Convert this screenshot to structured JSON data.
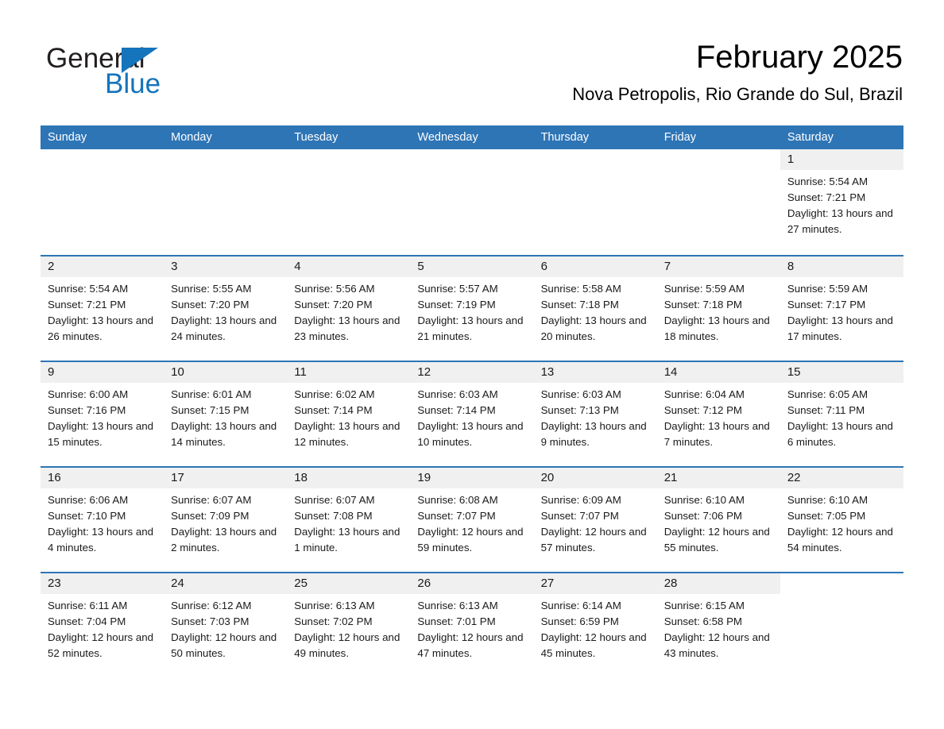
{
  "brand": {
    "name_part1": "General",
    "name_part2": "Blue",
    "accent_color": "#1474bc",
    "triangle_icon": "triangle-right-icon"
  },
  "header": {
    "title": "February 2025",
    "subtitle": "Nova Petropolis, Rio Grande do Sul, Brazil"
  },
  "colors": {
    "header_blue": "#2e75b6",
    "daynum_band": "#f0f0f0",
    "text": "#1a1a1a"
  },
  "weekdays": [
    "Sunday",
    "Monday",
    "Tuesday",
    "Wednesday",
    "Thursday",
    "Friday",
    "Saturday"
  ],
  "weeks": [
    [
      {
        "day": "",
        "sunrise": "",
        "sunset": "",
        "daylight": "",
        "empty": true
      },
      {
        "day": "",
        "sunrise": "",
        "sunset": "",
        "daylight": "",
        "empty": true
      },
      {
        "day": "",
        "sunrise": "",
        "sunset": "",
        "daylight": "",
        "empty": true
      },
      {
        "day": "",
        "sunrise": "",
        "sunset": "",
        "daylight": "",
        "empty": true
      },
      {
        "day": "",
        "sunrise": "",
        "sunset": "",
        "daylight": "",
        "empty": true
      },
      {
        "day": "",
        "sunrise": "",
        "sunset": "",
        "daylight": "",
        "empty": true
      },
      {
        "day": "1",
        "sunrise": "Sunrise: 5:54 AM",
        "sunset": "Sunset: 7:21 PM",
        "daylight": "Daylight: 13 hours and 27 minutes.",
        "empty": false
      }
    ],
    [
      {
        "day": "2",
        "sunrise": "Sunrise: 5:54 AM",
        "sunset": "Sunset: 7:21 PM",
        "daylight": "Daylight: 13 hours and 26 minutes.",
        "empty": false
      },
      {
        "day": "3",
        "sunrise": "Sunrise: 5:55 AM",
        "sunset": "Sunset: 7:20 PM",
        "daylight": "Daylight: 13 hours and 24 minutes.",
        "empty": false
      },
      {
        "day": "4",
        "sunrise": "Sunrise: 5:56 AM",
        "sunset": "Sunset: 7:20 PM",
        "daylight": "Daylight: 13 hours and 23 minutes.",
        "empty": false
      },
      {
        "day": "5",
        "sunrise": "Sunrise: 5:57 AM",
        "sunset": "Sunset: 7:19 PM",
        "daylight": "Daylight: 13 hours and 21 minutes.",
        "empty": false
      },
      {
        "day": "6",
        "sunrise": "Sunrise: 5:58 AM",
        "sunset": "Sunset: 7:18 PM",
        "daylight": "Daylight: 13 hours and 20 minutes.",
        "empty": false
      },
      {
        "day": "7",
        "sunrise": "Sunrise: 5:59 AM",
        "sunset": "Sunset: 7:18 PM",
        "daylight": "Daylight: 13 hours and 18 minutes.",
        "empty": false
      },
      {
        "day": "8",
        "sunrise": "Sunrise: 5:59 AM",
        "sunset": "Sunset: 7:17 PM",
        "daylight": "Daylight: 13 hours and 17 minutes.",
        "empty": false
      }
    ],
    [
      {
        "day": "9",
        "sunrise": "Sunrise: 6:00 AM",
        "sunset": "Sunset: 7:16 PM",
        "daylight": "Daylight: 13 hours and 15 minutes.",
        "empty": false
      },
      {
        "day": "10",
        "sunrise": "Sunrise: 6:01 AM",
        "sunset": "Sunset: 7:15 PM",
        "daylight": "Daylight: 13 hours and 14 minutes.",
        "empty": false
      },
      {
        "day": "11",
        "sunrise": "Sunrise: 6:02 AM",
        "sunset": "Sunset: 7:14 PM",
        "daylight": "Daylight: 13 hours and 12 minutes.",
        "empty": false
      },
      {
        "day": "12",
        "sunrise": "Sunrise: 6:03 AM",
        "sunset": "Sunset: 7:14 PM",
        "daylight": "Daylight: 13 hours and 10 minutes.",
        "empty": false
      },
      {
        "day": "13",
        "sunrise": "Sunrise: 6:03 AM",
        "sunset": "Sunset: 7:13 PM",
        "daylight": "Daylight: 13 hours and 9 minutes.",
        "empty": false
      },
      {
        "day": "14",
        "sunrise": "Sunrise: 6:04 AM",
        "sunset": "Sunset: 7:12 PM",
        "daylight": "Daylight: 13 hours and 7 minutes.",
        "empty": false
      },
      {
        "day": "15",
        "sunrise": "Sunrise: 6:05 AM",
        "sunset": "Sunset: 7:11 PM",
        "daylight": "Daylight: 13 hours and 6 minutes.",
        "empty": false
      }
    ],
    [
      {
        "day": "16",
        "sunrise": "Sunrise: 6:06 AM",
        "sunset": "Sunset: 7:10 PM",
        "daylight": "Daylight: 13 hours and 4 minutes.",
        "empty": false
      },
      {
        "day": "17",
        "sunrise": "Sunrise: 6:07 AM",
        "sunset": "Sunset: 7:09 PM",
        "daylight": "Daylight: 13 hours and 2 minutes.",
        "empty": false
      },
      {
        "day": "18",
        "sunrise": "Sunrise: 6:07 AM",
        "sunset": "Sunset: 7:08 PM",
        "daylight": "Daylight: 13 hours and 1 minute.",
        "empty": false
      },
      {
        "day": "19",
        "sunrise": "Sunrise: 6:08 AM",
        "sunset": "Sunset: 7:07 PM",
        "daylight": "Daylight: 12 hours and 59 minutes.",
        "empty": false
      },
      {
        "day": "20",
        "sunrise": "Sunrise: 6:09 AM",
        "sunset": "Sunset: 7:07 PM",
        "daylight": "Daylight: 12 hours and 57 minutes.",
        "empty": false
      },
      {
        "day": "21",
        "sunrise": "Sunrise: 6:10 AM",
        "sunset": "Sunset: 7:06 PM",
        "daylight": "Daylight: 12 hours and 55 minutes.",
        "empty": false
      },
      {
        "day": "22",
        "sunrise": "Sunrise: 6:10 AM",
        "sunset": "Sunset: 7:05 PM",
        "daylight": "Daylight: 12 hours and 54 minutes.",
        "empty": false
      }
    ],
    [
      {
        "day": "23",
        "sunrise": "Sunrise: 6:11 AM",
        "sunset": "Sunset: 7:04 PM",
        "daylight": "Daylight: 12 hours and 52 minutes.",
        "empty": false
      },
      {
        "day": "24",
        "sunrise": "Sunrise: 6:12 AM",
        "sunset": "Sunset: 7:03 PM",
        "daylight": "Daylight: 12 hours and 50 minutes.",
        "empty": false
      },
      {
        "day": "25",
        "sunrise": "Sunrise: 6:13 AM",
        "sunset": "Sunset: 7:02 PM",
        "daylight": "Daylight: 12 hours and 49 minutes.",
        "empty": false
      },
      {
        "day": "26",
        "sunrise": "Sunrise: 6:13 AM",
        "sunset": "Sunset: 7:01 PM",
        "daylight": "Daylight: 12 hours and 47 minutes.",
        "empty": false
      },
      {
        "day": "27",
        "sunrise": "Sunrise: 6:14 AM",
        "sunset": "Sunset: 6:59 PM",
        "daylight": "Daylight: 12 hours and 45 minutes.",
        "empty": false
      },
      {
        "day": "28",
        "sunrise": "Sunrise: 6:15 AM",
        "sunset": "Sunset: 6:58 PM",
        "daylight": "Daylight: 12 hours and 43 minutes.",
        "empty": false
      },
      {
        "day": "",
        "sunrise": "",
        "sunset": "",
        "daylight": "",
        "empty": true
      }
    ]
  ]
}
